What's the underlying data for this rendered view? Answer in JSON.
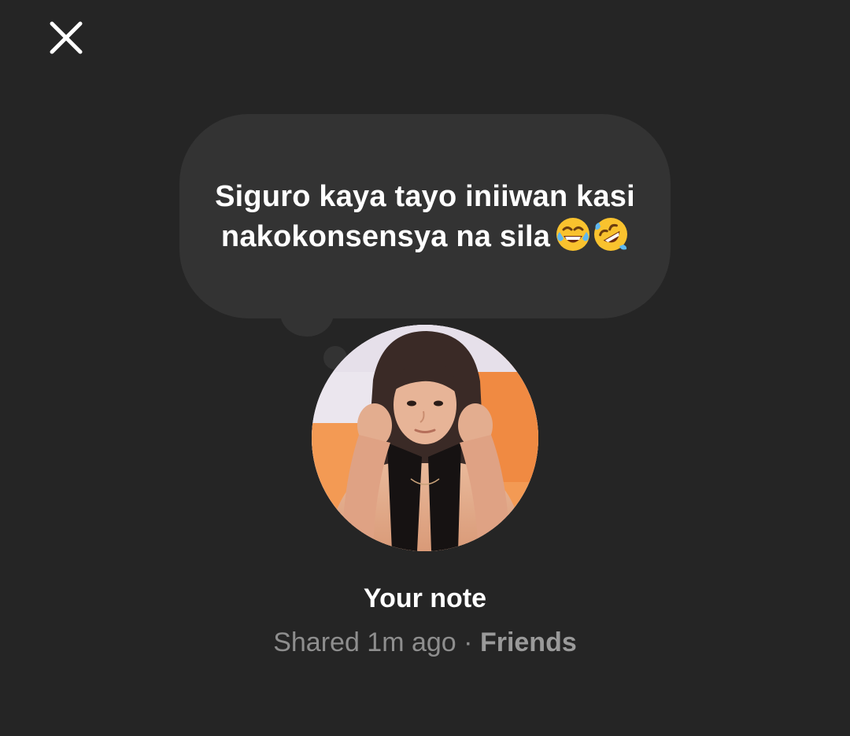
{
  "note": {
    "text_line1": "Siguro kaya tayo iniiwan kasi",
    "text_line2": "nakokonsensya na sila",
    "emojis": [
      "face-with-tears-of-joy",
      "rolling-on-the-floor-laughing"
    ],
    "title": "Your note",
    "shared": "Shared 1m ago",
    "separator": "·",
    "audience": "Friends"
  },
  "icons": {
    "close": "close-icon"
  },
  "colors": {
    "background": "#252525",
    "bubble": "#333333",
    "text": "#ffffff",
    "meta": "#8e8e8e"
  }
}
